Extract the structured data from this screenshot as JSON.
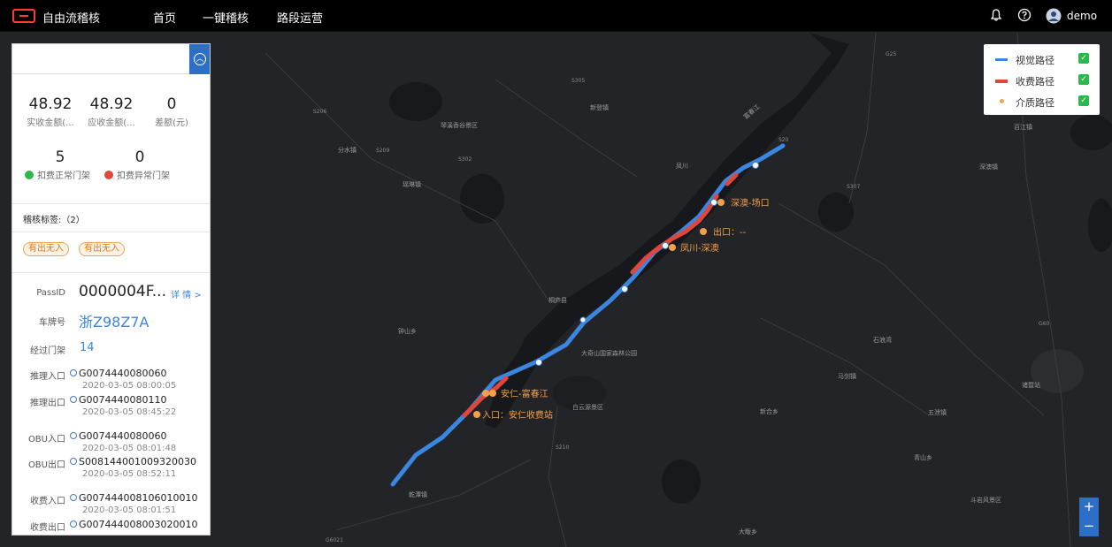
{
  "header": {
    "app_title": "自由流稽核",
    "nav": [
      "首页",
      "一键稽核",
      "路段运营"
    ],
    "icons": [
      "bell-icon",
      "help-icon",
      "user-avatar-icon"
    ],
    "user_name": "demo"
  },
  "stats": {
    "actual_amount": "48.92",
    "actual_label": "实收金额(...",
    "due_amount": "48.92",
    "due_label": "应收金额(...",
    "diff_amount": "0",
    "diff_label": "差额(元)",
    "normal_gates": "5",
    "normal_label": "扣费正常门架",
    "abnormal_gates": "0",
    "abnormal_label": "扣费异常门架"
  },
  "audit_tags": {
    "title": "稽核标签:（2）",
    "tags": [
      "有出无入",
      "有出无入"
    ]
  },
  "pass": {
    "passid_label": "PassID",
    "passid_value": "0000004F...",
    "detail_link": "详 情 >",
    "plate_label": "车牌号",
    "plate_value": "浙Z98Z7A",
    "gates_label": "经过门架",
    "gates_value": "14",
    "rows": [
      {
        "label": "推理入口",
        "value": "G0074440080060",
        "time": "2020-03-05 08:00:05"
      },
      {
        "label": "推理出口",
        "value": "G0074440080110",
        "time": "2020-03-05 08:45:22"
      },
      {
        "label": "OBU入口",
        "value": "G0074440080060",
        "time": "2020-03-05 08:01:48"
      },
      {
        "label": "OBU出口",
        "value": "S008144001009320030",
        "time": "2020-03-05 08:52:11"
      },
      {
        "label": "收费入口",
        "value": "G007444008106010010",
        "time": "2020-03-05 08:01:51"
      },
      {
        "label": "收费出口",
        "value": "G007444008003020010",
        "time": ""
      }
    ]
  },
  "legend": {
    "items": [
      {
        "label": "视觉路径",
        "color": "#3a86e0"
      },
      {
        "label": "收费路径",
        "color": "#e0463b"
      },
      {
        "label": "介质路径",
        "color": "#f5a04a"
      }
    ]
  },
  "map": {
    "road_colors": {
      "visual": "#3a86e0",
      "toll": "#e0463b",
      "medium": "#f5a04a"
    },
    "labels": {
      "station_1": "深澳-场口",
      "exit": "出口：--",
      "station_2": "凤川-深澳",
      "station_3": "安仁-富春江",
      "entry": "入口：安仁收费站",
      "river": "富春江",
      "county": "桐庐县",
      "park": "大奇山国家森林公园",
      "scenic_1": "琴溪香谷景区",
      "scenic_2": "白云源景区",
      "scenic_3": "斗岩风景区",
      "station_4": "诸暨站",
      "village_1": "分水镇",
      "village_2": "瑶琳镇",
      "village_3": "新登镇",
      "village_4": "石浪湾",
      "village_5": "钟山乡",
      "village_6": "百江镇",
      "village_7": "凤川",
      "village_8": "深澳镇",
      "village_9": "新合乡",
      "village_10": "五泄镇",
      "village_11": "乾潭镇",
      "village_12": "大畈乡",
      "village_13": "马剑镇",
      "village_14": "青山乡"
    },
    "road_codes": [
      "S206",
      "S305",
      "S302",
      "S209",
      "S307",
      "G25",
      "S210",
      "G60",
      "G6021",
      "S20"
    ]
  },
  "zoom": {
    "in": "+",
    "out": "−"
  }
}
